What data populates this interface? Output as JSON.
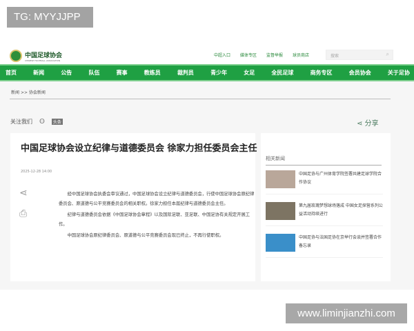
{
  "overlay_tag": "TG: MYYJJPP",
  "watermark": "www.liminjianzhi.com",
  "header": {
    "logo_text": "中国足球协会",
    "logo_sub": "CHINESE FOOTBALL ASSOCIATION",
    "top_links": [
      "中超入口",
      "媒体专区",
      "监督举报",
      "球员商店"
    ],
    "search_placeholder": "搜索"
  },
  "nav": [
    "首页",
    "新闻",
    "公告",
    "队伍",
    "赛事",
    "教练员",
    "裁判员",
    "青少年",
    "女足",
    "全民足球",
    "商务专区",
    "会员协会",
    "关于足协"
  ],
  "breadcrumb": {
    "home": "新闻",
    "sep": ">>",
    "current": "协会新闻"
  },
  "follow": {
    "label": "关注我们",
    "badge": "头条"
  },
  "share_label": "分享",
  "article": {
    "title": "中国足球协会设立纪律与道德委员会 徐家力担任委员会主任",
    "date": "2025-12-28 14:00",
    "paragraphs": [
      "经中国足球协会执委会审议通过，中国足球协会设立纪律与道德委员会，行使中国足球协会原纪律委员会、原道德与公平竞赛委员会的相关职权。徐家力担任本届纪律与道德委员会主任。",
      "纪律与道德委员会依据《中国足球协会章程》以及国际足联、亚足联、中国足协有关规定开展工作。",
      "中国足球协会原纪律委员会、原道德与公平竞赛委员会现已终止，不再行使职权。"
    ]
  },
  "related": {
    "title": "相关新闻",
    "items": [
      {
        "text": "中国足协与广州体育学院签署共建足球学院合作协议",
        "thumb": "#b9a79a"
      },
      {
        "text": "第九届玫瑰梦想球场落成 中国女足探营系列公益活动持续进行",
        "thumb": "#7d7463"
      },
      {
        "text": "中国足协与法国足协在京举行会谈并签署合作备忘录",
        "thumb": "#3a8fc9"
      }
    ]
  },
  "colors": {
    "nav_green": "#1fa043"
  }
}
